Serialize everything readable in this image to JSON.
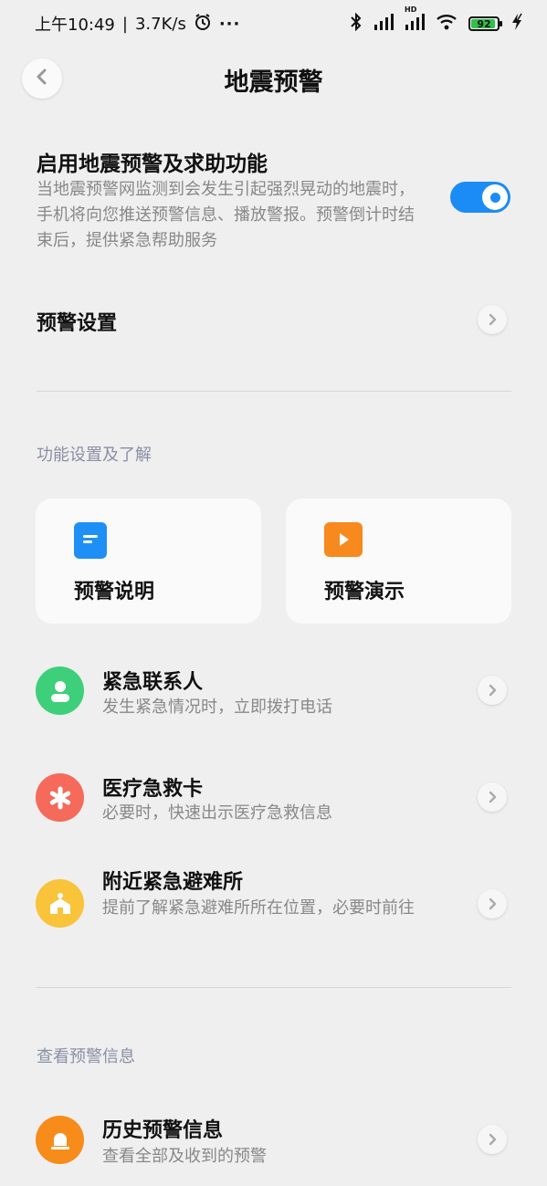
{
  "status_bar": {
    "time": "上午10:49",
    "separator": "|",
    "speed": "3.7K/s",
    "more": "···",
    "hd": "HD",
    "battery": "92"
  },
  "header": {
    "title": "地震预警"
  },
  "enable": {
    "title": "启用地震预警及求助功能",
    "desc": "当地震预警网监测到会发生引起强烈晃动的地震时，手机将向您推送预警信息、播放警报。预警倒计时结束后，提供紧急帮助服务",
    "enabled": true
  },
  "settings_row": {
    "label": "预警设置"
  },
  "section_features": {
    "label": "功能设置及了解",
    "cards": [
      {
        "label": "预警说明",
        "icon": "document-icon",
        "color": "#1e90f5"
      },
      {
        "label": "预警演示",
        "icon": "play-icon",
        "color": "#f7891e"
      }
    ]
  },
  "feature_rows": [
    {
      "title": "紧急联系人",
      "sub": "发生紧急情况时，立即拨打电话",
      "icon": "contact-person-icon",
      "color": "#3ecf7a"
    },
    {
      "title": "医疗急救卡",
      "sub": "必要时，快速出示医疗急救信息",
      "icon": "medical-asterisk-icon",
      "color": "#f56a5b"
    },
    {
      "title": "附近紧急避难所",
      "sub": "提前了解紧急避难所所在位置，必要时前往",
      "icon": "shelter-icon",
      "color": "#f9c33a"
    }
  ],
  "section_info": {
    "label": "查看预警信息",
    "rows": [
      {
        "title": "历史预警信息",
        "sub": "查看全部及收到的预警",
        "icon": "alarm-bell-icon",
        "color": "#f78c1b"
      }
    ]
  }
}
